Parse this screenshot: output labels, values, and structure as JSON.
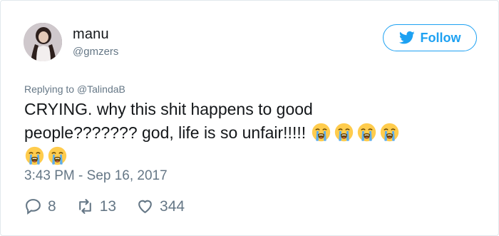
{
  "tweet": {
    "user": {
      "display_name": "manu",
      "handle": "@gmzers"
    },
    "follow_label": "Follow",
    "replying_prefix": "Replying to ",
    "replying_to": "@TalindaB",
    "text_line1": "CRYING. why this shit happens to good",
    "text_line2": "people??????? god, life is so unfair!!!!!",
    "emoji_name": "loudly-crying-face-emoji",
    "emoji_count_line2": 4,
    "emoji_count_line3": 2,
    "timestamp": "3:43 PM - Sep 16, 2017",
    "counts": {
      "replies": "8",
      "retweets": "13",
      "likes": "344"
    }
  },
  "colors": {
    "brand_blue": "#1da1f2",
    "secondary_text": "#657786",
    "border": "#e1e8ed"
  }
}
